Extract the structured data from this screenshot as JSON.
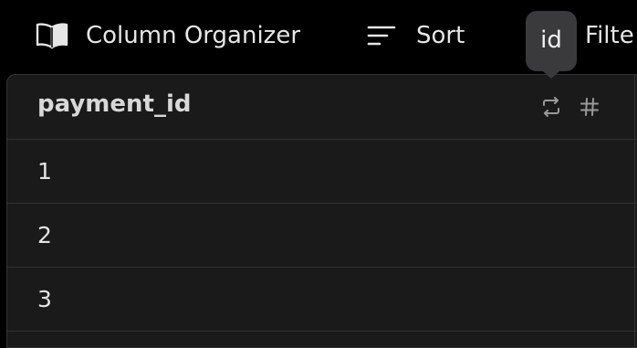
{
  "toolbar": {
    "column_organizer_label": "Column Organizer",
    "sort_label": "Sort",
    "filter_label": "Filte",
    "organizer_icon": "book-open-icon",
    "sort_icon": "sort-lines-icon"
  },
  "tooltip": {
    "text": "id"
  },
  "table": {
    "column_header": "payment_id",
    "header_icons": [
      "swap-arrows-icon",
      "hash-icon"
    ],
    "rows": [
      "1",
      "2",
      "3"
    ]
  },
  "colors": {
    "background": "#000000",
    "grid_background": "#1a1a1a",
    "tooltip_background": "#3a3a3c",
    "divider": "#323232"
  }
}
